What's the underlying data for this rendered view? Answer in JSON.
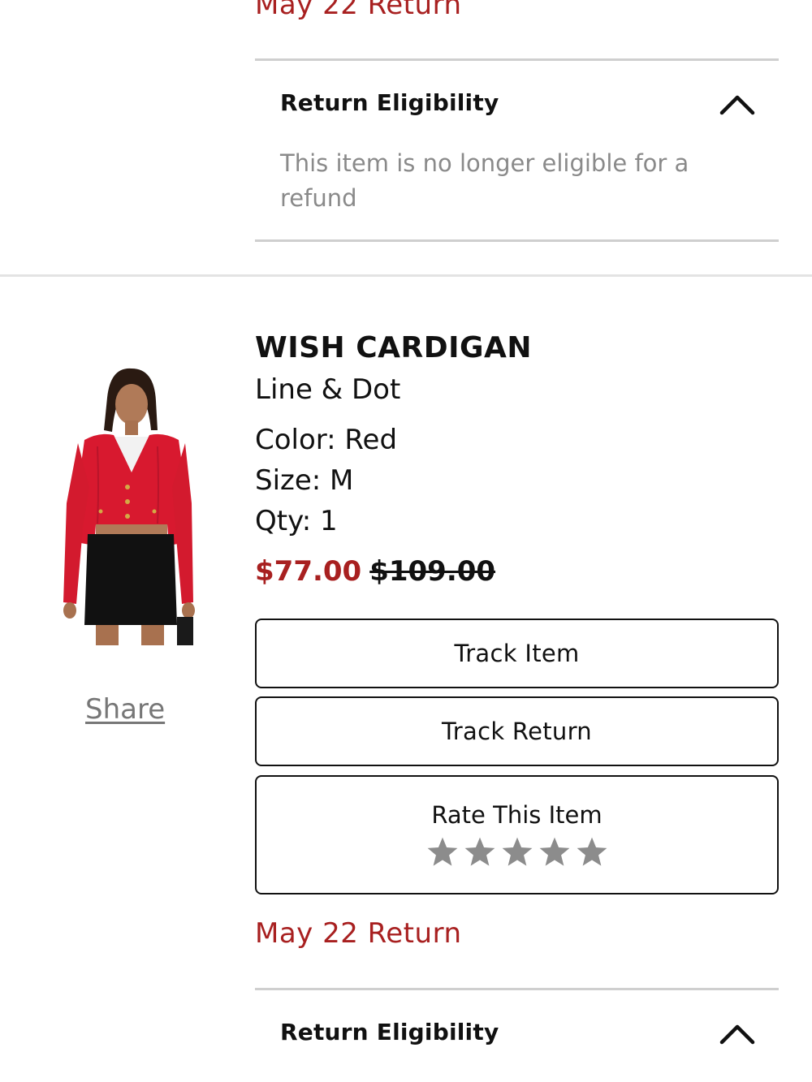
{
  "top": {
    "return_date": "May 22 Return",
    "eligibility_title": "Return Eligibility",
    "eligibility_text": "This item is no longer eligible for a refund"
  },
  "product": {
    "name": "WISH CARDIGAN",
    "brand": "Line & Dot",
    "color": "Color: Red",
    "size": "Size: M",
    "qty": "Qty: 1",
    "sale_price": "$77.00",
    "original_price": "$109.00",
    "image_icon": "product-photo-red-cardigan",
    "share_label": "Share",
    "buttons": {
      "track_item": "Track Item",
      "track_return": "Track Return"
    },
    "rating": {
      "label": "Rate This Item",
      "max_stars": 5,
      "current": 0,
      "star_color": "#8c8c8c"
    },
    "return_date": "May 22 Return",
    "eligibility_title": "Return Eligibility",
    "chevron_icon": "chevron-up-icon"
  },
  "colors": {
    "accent_red": "#a82020",
    "muted_text": "#8a8a8a",
    "divider": "#cfcfcf"
  }
}
